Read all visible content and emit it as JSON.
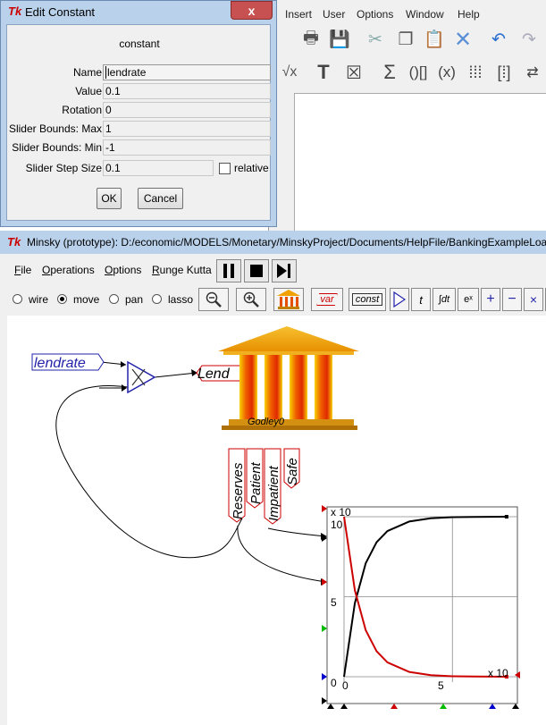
{
  "background_app": {
    "menus": [
      "Insert",
      "User",
      "Options",
      "Window",
      "Help"
    ]
  },
  "dialog": {
    "title": "Edit Constant",
    "close_glyph": "x",
    "heading": "constant",
    "rows": [
      {
        "label": "Name",
        "value": "lendrate"
      },
      {
        "label": "Value",
        "value": "0.1"
      },
      {
        "label": "Rotation",
        "value": "0"
      },
      {
        "label": "Slider Bounds: Max",
        "value": "1"
      },
      {
        "label": "Slider Bounds: Min",
        "value": "-1"
      },
      {
        "label": "Slider Step Size",
        "value": "0.1"
      }
    ],
    "relative_label": "relative",
    "relative_checked": false,
    "ok_label": "OK",
    "cancel_label": "Cancel"
  },
  "minsky": {
    "title": "Minsky (prototype): D:/economic/MODELS/Monetary/MinskyProject/Documents/HelpFile/BankingExampleLoa",
    "menus": [
      {
        "first": "F",
        "rest": "ile"
      },
      {
        "first": "O",
        "rest": "perations"
      },
      {
        "first": "O",
        "rest": "ptions"
      },
      {
        "first": "R",
        "rest": "unge Kutta"
      }
    ],
    "modes": [
      {
        "label": "wire",
        "selected": false
      },
      {
        "label": "move",
        "selected": true
      },
      {
        "label": "pan",
        "selected": false
      },
      {
        "label": "lasso",
        "selected": false
      }
    ],
    "tools": {
      "var": "var",
      "const": "const",
      "time": "t",
      "integral": "∫dt",
      "exp": "eˣ"
    },
    "canvas": {
      "lendrate_var": "lendrate",
      "lend_var": "Lend",
      "godley_label": "Godley0",
      "stocks": [
        "Reserves",
        "Patient",
        "Impatient",
        "Safe"
      ],
      "plot": {
        "y_multiplier": "x 10",
        "x_multiplier": "x 10",
        "y_ticks": [
          "10",
          "5",
          "0"
        ],
        "x_ticks": [
          "0",
          "5"
        ]
      }
    }
  },
  "chart_data": {
    "type": "line",
    "x": [
      0,
      0.5,
      1,
      1.5,
      2,
      3,
      4,
      5,
      6,
      7.5
    ],
    "series": [
      {
        "color": "#000000",
        "values": [
          0,
          46,
          71,
          84,
          91,
          97,
          99,
          99.7,
          99.9,
          100
        ]
      },
      {
        "color": "#cc0000",
        "values": [
          100,
          54,
          29,
          16,
          9,
          3,
          1,
          0.3,
          0.1,
          0
        ]
      }
    ],
    "xlim": [
      0,
      8
    ],
    "ylim": [
      0,
      100
    ],
    "grid": true
  }
}
